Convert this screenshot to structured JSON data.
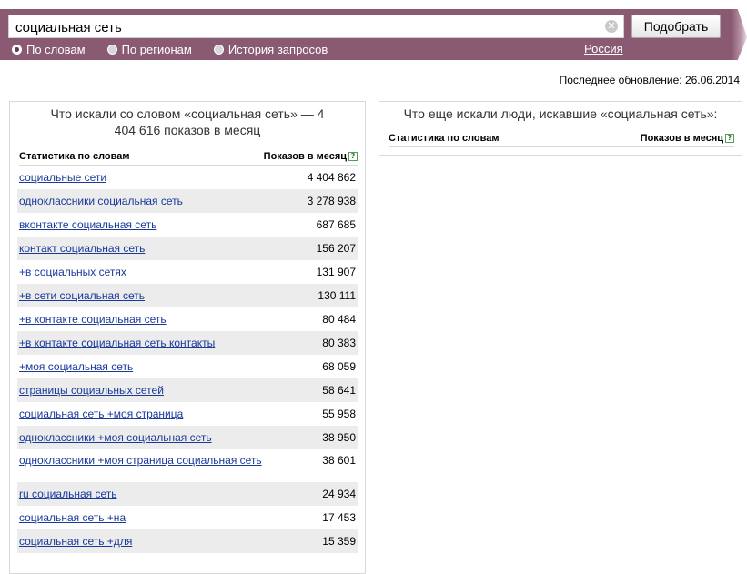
{
  "search": {
    "query": "социальная сеть",
    "submit_label": "Подобрать",
    "clear_glyph": "✕"
  },
  "modes": [
    {
      "label": "По словам",
      "checked": true
    },
    {
      "label": "По регионам",
      "checked": false
    },
    {
      "label": "История запросов",
      "checked": false
    }
  ],
  "region": "Россия",
  "last_update": "Последнее обновление: 26.06.2014",
  "left_panel": {
    "title": "Что искали со словом «социальная сеть» — 4 404 616 показов в месяц",
    "col_keyword": "Статистика по словам",
    "col_count": "Показов в месяц",
    "help": "?",
    "rows": [
      {
        "keyword": "социальные сети",
        "count": "4 404 862"
      },
      {
        "keyword": "одноклассники социальная сеть",
        "count": "3 278 938"
      },
      {
        "keyword": "вконтакте социальная сеть",
        "count": "687 685"
      },
      {
        "keyword": "контакт социальная сеть",
        "count": "156 207"
      },
      {
        "keyword": "+в социальных сетях",
        "count": "131 907"
      },
      {
        "keyword": "+в сети социальная сеть",
        "count": "130 111"
      },
      {
        "keyword": "+в контакте социальная сеть",
        "count": "80 484"
      },
      {
        "keyword": "+в контакте социальная сеть контакты",
        "count": "80 383"
      },
      {
        "keyword": "+моя социальная сеть",
        "count": "68 059"
      },
      {
        "keyword": "страницы социальных сетей",
        "count": "58 641"
      },
      {
        "keyword": "социальная сеть +моя страница",
        "count": "55 958"
      },
      {
        "keyword": "одноклассники +моя социальная сеть",
        "count": "38 950"
      },
      {
        "keyword": "одноклассники +моя страница социальная сеть",
        "count": "38 601"
      },
      {
        "keyword": "ru социальная сеть",
        "count": "24 934"
      },
      {
        "keyword": "социальная сеть +на",
        "count": "17 453"
      },
      {
        "keyword": "социальная сеть +для",
        "count": "15 359"
      }
    ]
  },
  "right_panel": {
    "title": "Что еще искали люди, искавшие «социальная сеть»:",
    "col_keyword": "Статистика по словам",
    "col_count": "Показов в месяц",
    "help": "?"
  }
}
